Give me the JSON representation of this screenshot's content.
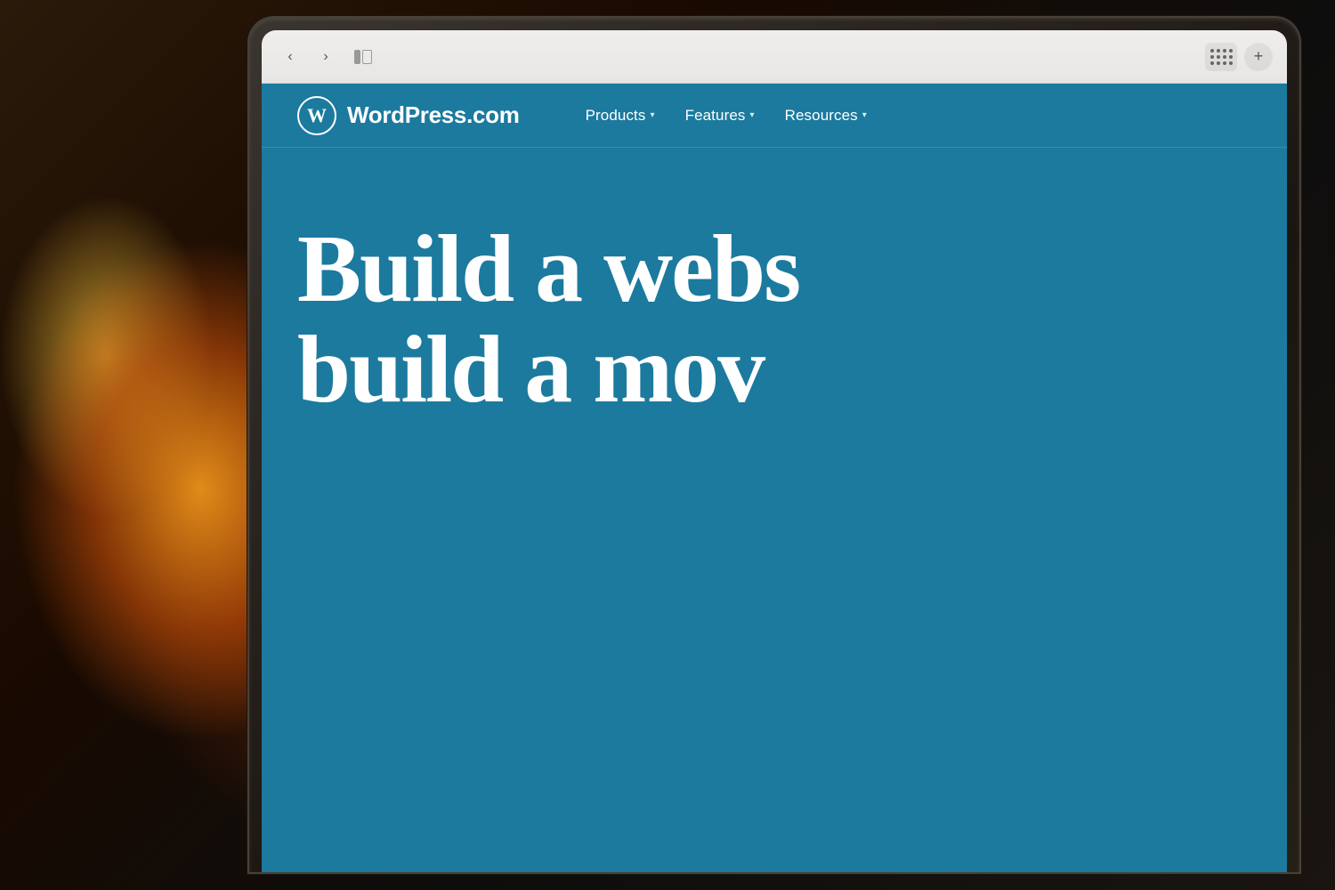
{
  "background": {
    "color": "#1a1a1a"
  },
  "browser": {
    "back_icon": "‹",
    "forward_icon": "›",
    "new_tab_icon": "+",
    "grid_icon": "grid"
  },
  "website": {
    "logo": {
      "symbol": "W",
      "text": "WordPress.com"
    },
    "nav": {
      "items": [
        {
          "label": "Products",
          "has_dropdown": true
        },
        {
          "label": "Features",
          "has_dropdown": true
        },
        {
          "label": "Resources",
          "has_dropdown": true
        }
      ]
    },
    "hero": {
      "line1": "Build a webs",
      "line2": "build a mov"
    }
  }
}
